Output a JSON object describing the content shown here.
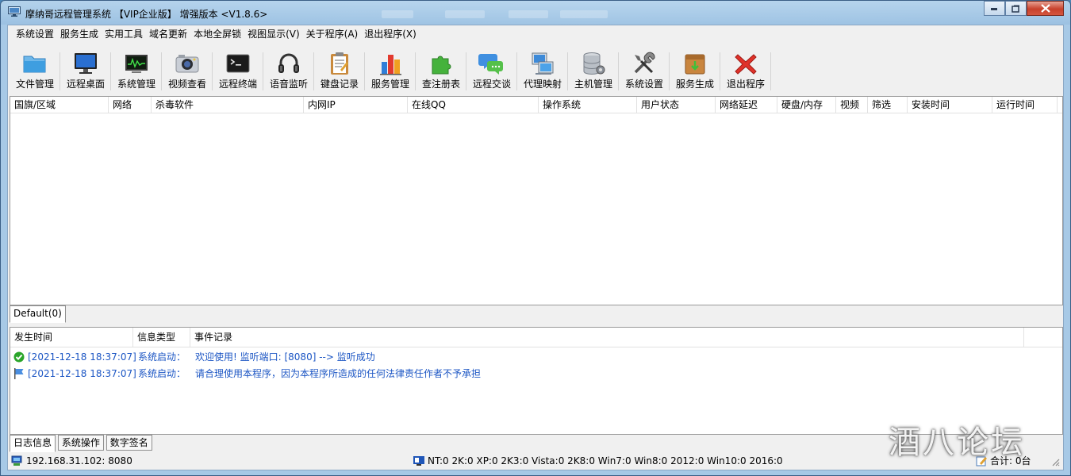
{
  "window": {
    "title": "摩纳哥远程管理系统 【VIP企业版】 增强版本 <V1.8.6>"
  },
  "menu": [
    "系统设置",
    "服务生成",
    "实用工具",
    "域名更新",
    "本地全屏锁",
    "视图显示(V)",
    "关于程序(A)",
    "退出程序(X)"
  ],
  "toolbar": [
    {
      "label": "文件管理",
      "icon": "folder-icon"
    },
    {
      "label": "远程桌面",
      "icon": "monitor-icon"
    },
    {
      "label": "系统管理",
      "icon": "system-monitor-icon"
    },
    {
      "label": "视频查看",
      "icon": "camera-icon"
    },
    {
      "label": "远程终端",
      "icon": "terminal-icon"
    },
    {
      "label": "语音监听",
      "icon": "headset-icon"
    },
    {
      "label": "键盘记录",
      "icon": "clipboard-icon"
    },
    {
      "label": "服务管理",
      "icon": "bar-chart-icon"
    },
    {
      "label": "查注册表",
      "icon": "puzzle-icon"
    },
    {
      "label": "远程交谈",
      "icon": "chat-icon"
    },
    {
      "label": "代理映射",
      "icon": "network-icon"
    },
    {
      "label": "主机管理",
      "icon": "database-icon"
    },
    {
      "label": "系统设置",
      "icon": "tools-icon"
    },
    {
      "label": "服务生成",
      "icon": "package-icon"
    },
    {
      "label": "退出程序",
      "icon": "red-x-icon"
    }
  ],
  "hosts_table": {
    "columns": [
      "国旗/区域",
      "网络",
      "杀毒软件",
      "内网IP",
      "在线QQ",
      "操作系统",
      "用户状态",
      "网络延迟",
      "硬盘/内存",
      "视频",
      "筛选",
      "安装时间",
      "运行时间"
    ],
    "rows": []
  },
  "group_tabs": [
    "Default(0)"
  ],
  "log_table": {
    "columns": [
      "发生时间",
      "信息类型",
      "事件记录"
    ],
    "rows": [
      {
        "icon": "check-icon",
        "time": "[2021-12-18 18:37:07]",
        "type": "系统启动：",
        "event": "欢迎使用!   监听端口: [8080] --> 监听成功"
      },
      {
        "icon": "flag-icon",
        "time": "[2021-12-18 18:37:07]",
        "type": "系统启动：",
        "event": "请合理使用本程序，因为本程序所造成的任何法律责任作者不予承担"
      }
    ]
  },
  "bottom_tabs": [
    "日志信息",
    "系统操作",
    "数字签名"
  ],
  "status": {
    "listen": "192.168.31.102: 8080",
    "os_stats": "NT:0   2K:0   XP:0   2K3:0   Vista:0   2K8:0   Win7:0   Win8:0   2012:0   Win10:0   2016:0",
    "total": "合计: 0台"
  },
  "watermark": "酒八论坛"
}
